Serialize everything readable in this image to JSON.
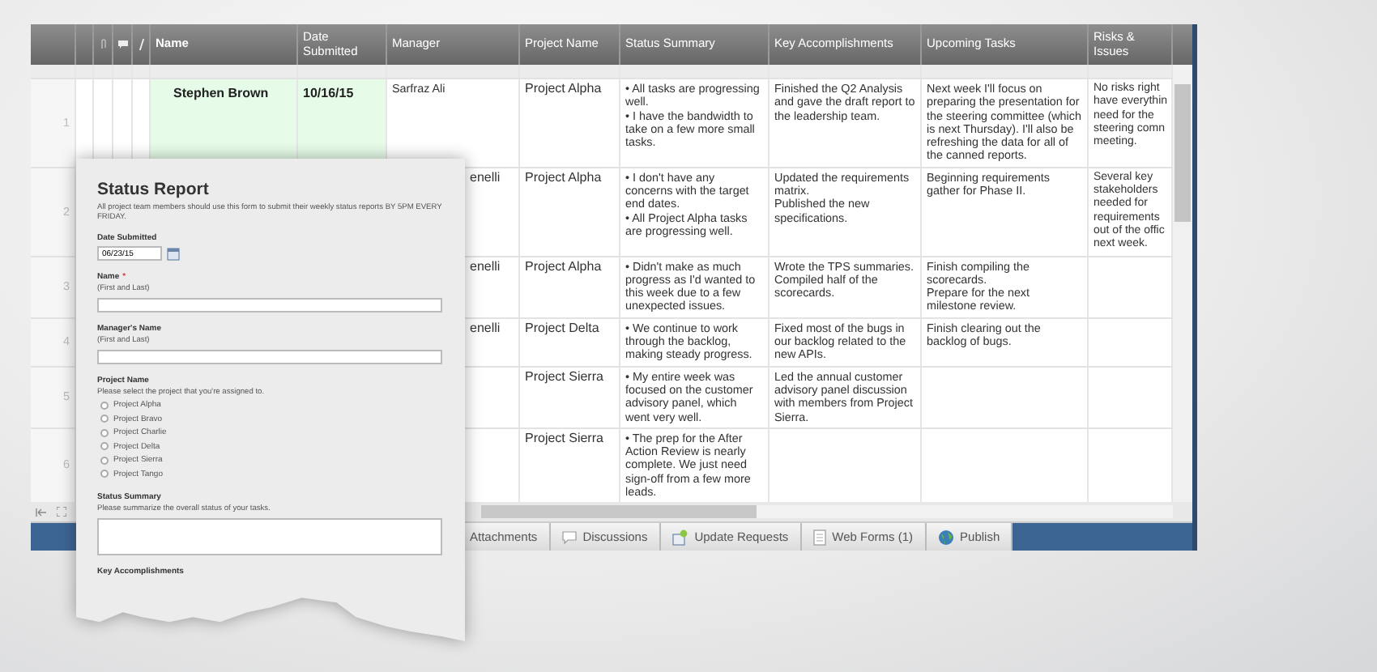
{
  "table": {
    "columns": [
      "Name",
      "Date Submitted",
      "Manager",
      "Project Name",
      "Status Summary",
      "Key Accomplishments",
      "Upcoming Tasks",
      "Risks & Issues"
    ],
    "rows": [
      {
        "number": "1",
        "name": "Stephen Brown",
        "date": "10/16/15",
        "manager": "Sarfraz Ali",
        "project": "Project Alpha",
        "status": "• All tasks are progressing well.\n• I have the bandwidth to take on a few more small tasks.",
        "accomplishments": "Finished the Q2 Analysis and gave the draft report to the leadership team.",
        "upcoming": "Next week I'll focus on preparing the presentation for the steering committee (which is next Thursday). I'll also be refreshing the data for all of the canned reports.",
        "risks": [
          "No risks right",
          "have everythin",
          "need for the",
          "steering comn",
          "meeting."
        ],
        "highlighted": true
      },
      {
        "number": "2",
        "manager": "enelli",
        "project": "Project Alpha",
        "status": "• I don't have any concerns with the target end dates.\n• All Project Alpha tasks are progressing well.",
        "accomplishments": "Updated the requirements matrix.\nPublished the new specifications.",
        "upcoming": "Beginning requirements gather for Phase II.",
        "risks": [
          "Several key",
          "stakeholders",
          "needed for",
          "requirements",
          "out of the offic",
          "next week."
        ]
      },
      {
        "number": "3",
        "manager": "enelli",
        "project": "Project Alpha",
        "status": "• Didn't make as much progress as I'd wanted to this week due to a few unexpected issues.",
        "accomplishments": "Wrote the TPS summaries.\nCompiled half of the scorecards.",
        "upcoming": "Finish compiling the scorecards.\nPrepare for the next milestone review."
      },
      {
        "number": "4",
        "manager": "enelli",
        "project": "Project Delta",
        "status": "• We continue to work through the backlog, making steady progress.",
        "accomplishments": "Fixed most of the bugs in our backlog related to the new APIs.",
        "upcoming": "Finish clearing out the backlog of bugs."
      },
      {
        "number": "5",
        "project": "Project Sierra",
        "status": "• My entire week was focused on the customer advisory panel, which went very well.",
        "accomplishments": "Led the annual customer advisory panel discussion with members from Project Sierra."
      },
      {
        "number": "6",
        "project": "Project Sierra",
        "status": "• The prep for the After Action Review is nearly complete. We just need sign-off from a few more leads."
      }
    ]
  },
  "tabs": [
    {
      "label": "Attachments",
      "kind": "none"
    },
    {
      "label": "Discussions",
      "kind": "comment"
    },
    {
      "label": "Update Requests",
      "kind": "request"
    },
    {
      "label": "Web Forms (1)",
      "kind": "form"
    },
    {
      "label": "Publish",
      "kind": "globe"
    }
  ],
  "form": {
    "title": "Status Report",
    "description": "All project team members should use this form to submit their weekly status reports BY 5PM EVERY FRIDAY.",
    "fields": [
      {
        "kind": "date",
        "label": "Date Submitted",
        "value": "06/23/15"
      },
      {
        "kind": "text",
        "label": "Name",
        "required_mark": "*",
        "hint": "(First and Last)"
      },
      {
        "kind": "text",
        "label": "Manager's Name",
        "hint": "(First and Last)"
      },
      {
        "kind": "radio",
        "label": "Project Name",
        "hint": "Please select the project that you're assigned to.",
        "options": [
          {
            "label": "Project Alpha",
            "selected": false
          },
          {
            "label": "Project Bravo",
            "selected": false
          },
          {
            "label": "Project Charlie",
            "selected": false
          },
          {
            "label": "Project Delta",
            "selected": false
          },
          {
            "label": "Project Sierra",
            "selected": false
          },
          {
            "label": "Project Tango",
            "selected": false
          }
        ]
      },
      {
        "kind": "textarea",
        "label": "Status Summary",
        "hint": "Please summarize the overall status of your tasks."
      },
      {
        "kind": "heading",
        "label": "Key Accomplishments"
      }
    ]
  }
}
